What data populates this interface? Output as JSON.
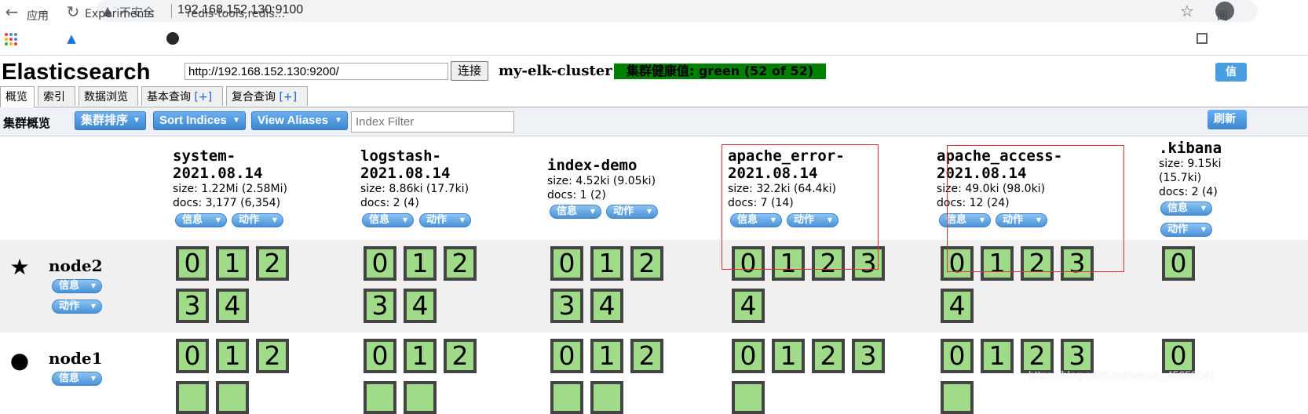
{
  "browser": {
    "security_label": "不安全",
    "url": "192.168.152.130:9100",
    "bookmarks": [
      "应用",
      "Experiments",
      "redis-tools,redis...",
      "阅"
    ]
  },
  "app": {
    "brand": "Elasticsearch",
    "connection_url": "http://192.168.152.130:9200/",
    "connect_label": "连接",
    "cluster_name": "my-elk-cluster",
    "health_text": "集群健康值: green (52 of 52)",
    "info_label": "信",
    "tabs": [
      {
        "label": "概览",
        "plus": ""
      },
      {
        "label": "索引",
        "plus": ""
      },
      {
        "label": "数据浏览",
        "plus": ""
      },
      {
        "label": "基本查询 ",
        "plus": "[+]"
      },
      {
        "label": "复合查询 ",
        "plus": "[+]"
      }
    ]
  },
  "toolbar": {
    "title": "集群概览",
    "cluster_sort": "集群排序",
    "sort_indices": "Sort Indices",
    "view_aliases": "View Aliases",
    "filter_placeholder": "Index Filter",
    "refresh": "刷新"
  },
  "index_buttons": {
    "info": "信息",
    "action": "动作"
  },
  "indices": [
    {
      "name": "system-\n2021.08.14",
      "size": "size: 1.22Mi (2.58Mi)",
      "docs": "docs: 3,177 (6,354)"
    },
    {
      "name": "logstash-\n2021.08.14",
      "size": "size: 8.86ki (17.7ki)",
      "docs": "docs: 2 (4)"
    },
    {
      "name": "index-demo",
      "size": "size: 4.52ki (9.05ki)",
      "docs": "docs: 1 (2)"
    },
    {
      "name": "apache_error-\n2021.08.14",
      "size": "size: 32.2ki (64.4ki)",
      "docs": "docs: 7 (14)"
    },
    {
      "name": "apache_access-\n2021.08.14",
      "size": "size: 49.0ki (98.0ki)",
      "docs": "docs: 12 (24)"
    },
    {
      "name": ".kibana",
      "size": "size: 9.15ki",
      "size2": "(15.7ki)",
      "docs": "docs: 2 (4)"
    }
  ],
  "nodes": [
    {
      "name": "node2",
      "marker_icon": "star-icon",
      "marker": "★"
    },
    {
      "name": "node1",
      "marker_icon": "circle-icon",
      "marker": "●"
    }
  ],
  "node2_shards": [
    [
      "0",
      "1",
      "2",
      "3",
      "4"
    ],
    [
      "0",
      "1",
      "2",
      "3",
      "4"
    ],
    [
      "0",
      "1",
      "2",
      "3",
      "4"
    ],
    [
      "0",
      "1",
      "2",
      "3",
      "4"
    ],
    [
      "0",
      "1",
      "2",
      "3",
      "4"
    ],
    [
      "0"
    ]
  ],
  "node1_shards": [
    [
      "0",
      "1",
      "2"
    ],
    [
      "0",
      "1",
      "2"
    ],
    [
      "0",
      "1",
      "2"
    ],
    [
      "0",
      "1",
      "2",
      "3"
    ],
    [
      "0",
      "1",
      "2",
      "3"
    ],
    [
      "0"
    ]
  ],
  "watermark": "https://blog.csdn.net/weixin_45659041",
  "colors": {
    "health": "#008000",
    "shard": "#9fdb88",
    "button": "#4a92d8",
    "highlight": "#e03030"
  }
}
